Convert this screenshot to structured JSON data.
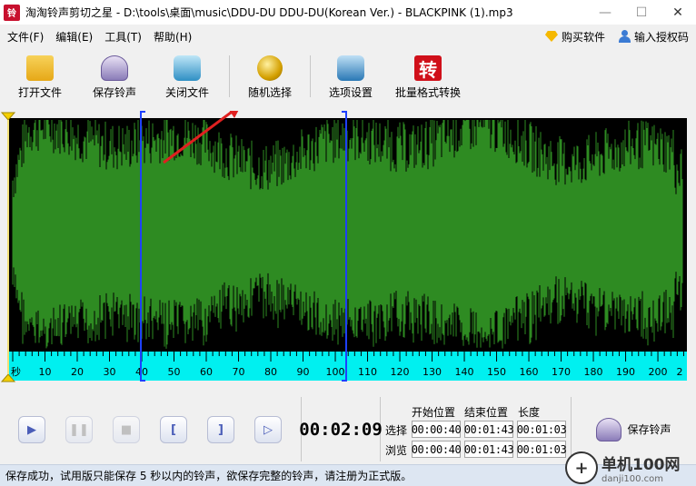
{
  "window": {
    "title": "淘淘铃声剪切之星 - D:\\tools\\桌面\\music\\DDU-DU DDU-DU(Korean Ver.) - BLACKPINK (1).mp3",
    "app_icon_text": "铃",
    "minimize": "—",
    "maximize": "☐",
    "close": "✕"
  },
  "menu": {
    "items": [
      "文件(F)",
      "编辑(E)",
      "工具(T)",
      "帮助(H)"
    ],
    "buy": "购买软件",
    "register": "输入授权码"
  },
  "toolbar": {
    "open": "打开文件",
    "save": "保存铃声",
    "close": "关闭文件",
    "random": "随机选择",
    "options": "选项设置",
    "convert": "批量格式转换",
    "convert_icon": "转"
  },
  "waveform": {
    "bg_color": "#000000",
    "wave_color": "#2e8b22",
    "ruler_color": "#00f0f0",
    "selection_color": "#1e40ff",
    "ruler_unit": "秒",
    "ruler_labels": [
      "10",
      "20",
      "30",
      "40",
      "50",
      "60",
      "70",
      "80",
      "90",
      "100",
      "110",
      "120",
      "130",
      "140",
      "150",
      "160",
      "170",
      "180",
      "190",
      "200",
      "2"
    ],
    "annotation_arrow_color": "#e02020"
  },
  "transport": {
    "time": "00:02:09",
    "head_start": "开始位置",
    "head_end": "结束位置",
    "head_len": "长度",
    "row_select": "选择",
    "row_browse": "浏览",
    "select_start": "00:00:40",
    "select_end": "00:01:43",
    "select_len": "00:01:03",
    "browse_start": "00:00:40",
    "browse_end": "00:01:43",
    "browse_len": "00:01:03",
    "save_ring": "保存铃声"
  },
  "status": {
    "text": "保存成功，试用版只能保存 5 秒以内的铃声，欲保存完整的铃声，请注册为正式版。"
  },
  "watermark": {
    "logo": "+",
    "cn": "单机100网",
    "url": "danji100.com"
  }
}
